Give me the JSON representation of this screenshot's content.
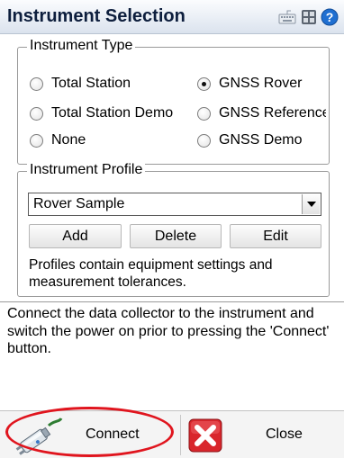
{
  "window": {
    "title": "Instrument Selection",
    "icons": [
      "keyboard-icon",
      "grid-icon",
      "help-icon"
    ]
  },
  "instrument_type": {
    "legend": "Instrument Type",
    "options": [
      {
        "label": "Total Station",
        "checked": false
      },
      {
        "label": "GNSS Rover",
        "checked": true
      },
      {
        "label": "Total Station Demo",
        "checked": false
      },
      {
        "label": "GNSS Reference",
        "checked": false
      },
      {
        "label": "None",
        "checked": false
      },
      {
        "label": "GNSS Demo",
        "checked": false
      }
    ]
  },
  "instrument_profile": {
    "legend": "Instrument Profile",
    "selected": "Rover Sample",
    "buttons": {
      "add": "Add",
      "delete": "Delete",
      "edit": "Edit"
    },
    "note": "Profiles contain equipment settings and measurement tolerances."
  },
  "info": "Connect the data collector to the instrument and switch the power on prior to pressing the 'Connect' button.",
  "bottom": {
    "connect_label": "Connect",
    "close_label": "Close",
    "icons": [
      "plug-icon",
      "close-x-icon"
    ]
  },
  "colors": {
    "title_text": "#0d1e3d",
    "highlight": "#e0151e",
    "close_icon": "#d9262c"
  }
}
